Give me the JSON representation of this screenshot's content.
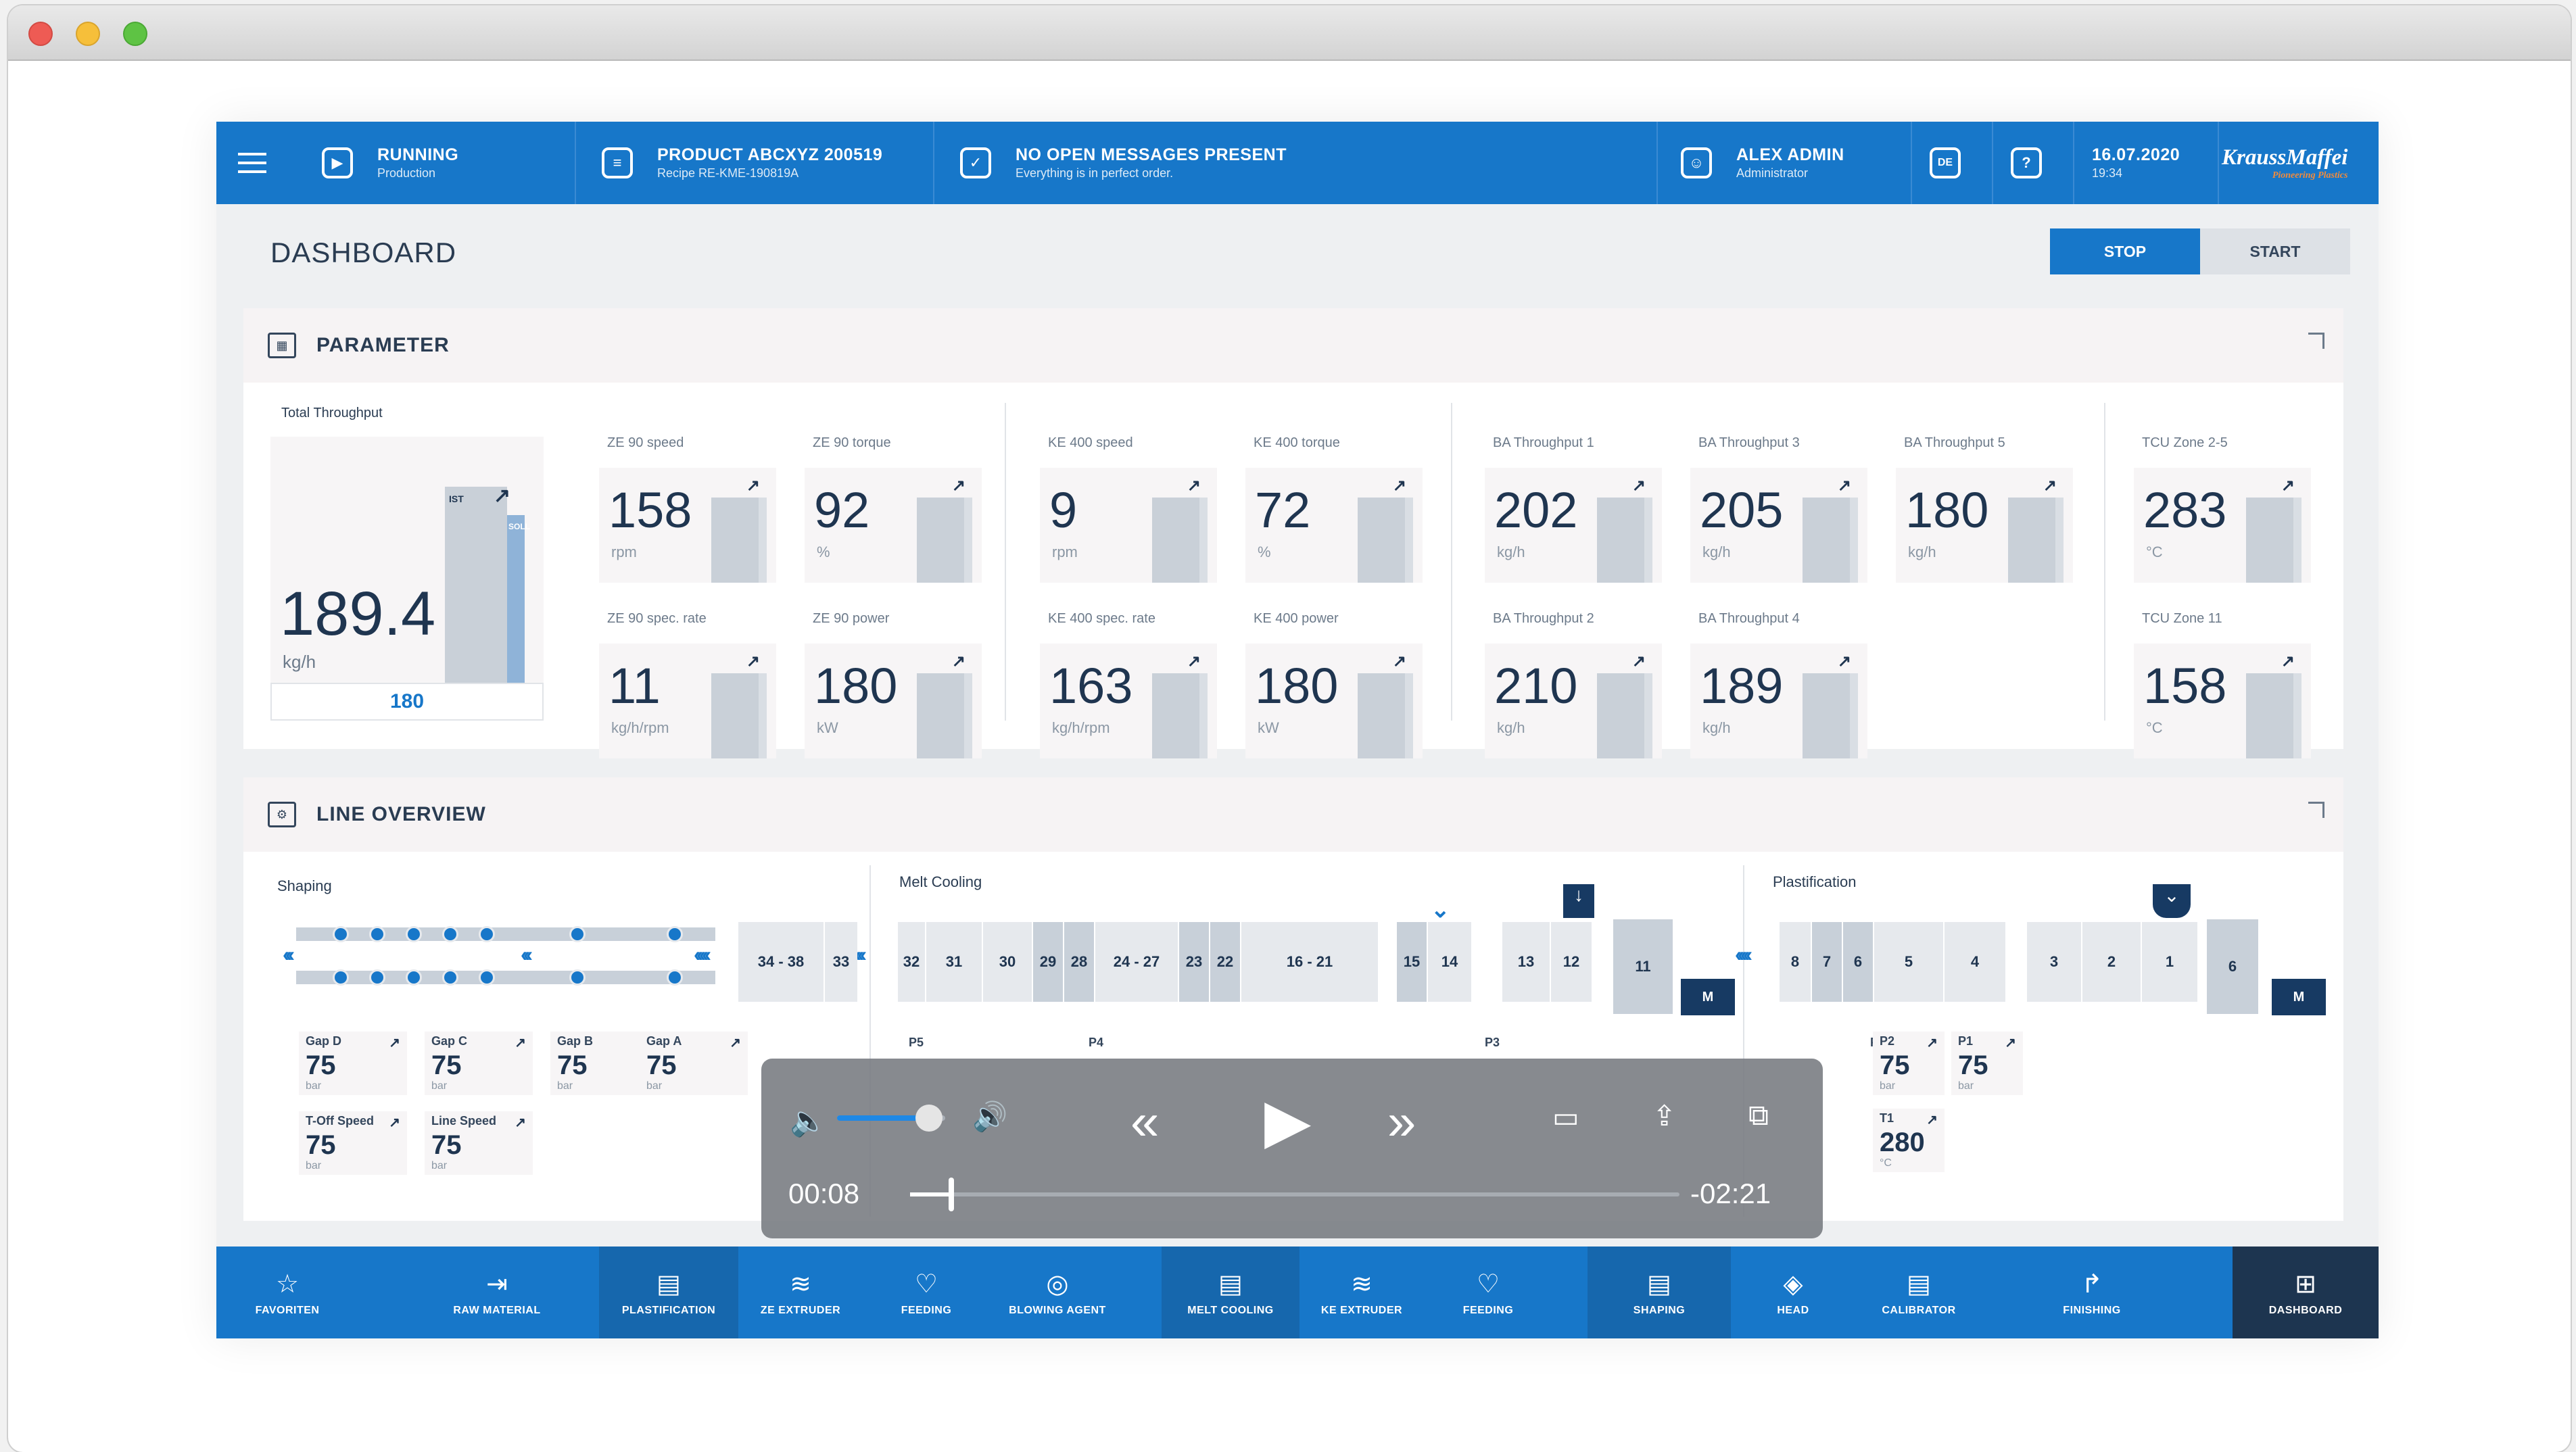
{
  "topbar": {
    "status": {
      "title": "RUNNING",
      "sub": "Production"
    },
    "product": {
      "title": "PRODUCT ABCXYZ 200519",
      "sub": "Recipe RE-KME-190819A"
    },
    "messages": {
      "title": "NO OPEN MESSAGES PRESENT",
      "sub": "Everything is in perfect order."
    },
    "user": {
      "title": "ALEX ADMIN",
      "sub": "Administrator"
    },
    "lang": "DE",
    "help": "?",
    "date": "16.07.2020",
    "time": "19:34",
    "brand": "KraussMaffei",
    "brand_tag": "Pioneering Plastics"
  },
  "page": {
    "title": "DASHBOARD",
    "stop": "STOP",
    "start": "START"
  },
  "parameter": {
    "title": "PARAMETER",
    "total": {
      "label": "Total Throughput",
      "value": "189.4",
      "unit": "kg/h",
      "target": "180",
      "ist": "IST",
      "soll": "SOLL"
    },
    "kpis": [
      {
        "label": "ZE 90 speed",
        "value": "158",
        "unit": "rpm"
      },
      {
        "label": "ZE 90 torque",
        "value": "92",
        "unit": "%"
      },
      {
        "label": "ZE 90 spec. rate",
        "value": "11",
        "unit": "kg/h/rpm"
      },
      {
        "label": "ZE 90 power",
        "value": "180",
        "unit": "kW"
      },
      {
        "label": "KE 400 speed",
        "value": "9",
        "unit": "rpm"
      },
      {
        "label": "KE 400 torque",
        "value": "72",
        "unit": "%"
      },
      {
        "label": "KE 400 spec. rate",
        "value": "163",
        "unit": "kg/h/rpm"
      },
      {
        "label": "KE 400 power",
        "value": "180",
        "unit": "kW"
      },
      {
        "label": "BA Throughput 1",
        "value": "202",
        "unit": "kg/h"
      },
      {
        "label": "BA Throughput 3",
        "value": "205",
        "unit": "kg/h"
      },
      {
        "label": "BA Throughput 5",
        "value": "180",
        "unit": "kg/h"
      },
      {
        "label": "BA Throughput 2",
        "value": "210",
        "unit": "kg/h"
      },
      {
        "label": "BA Throughput 4",
        "value": "189",
        "unit": "kg/h"
      },
      {
        "label": "TCU Zone 2-5",
        "value": "283",
        "unit": "°C"
      },
      {
        "label": "TCU Zone 11",
        "value": "158",
        "unit": "°C"
      }
    ]
  },
  "line": {
    "title": "LINE OVERVIEW",
    "zones": [
      "Shaping",
      "Melt Cooling",
      "Plastification"
    ],
    "segments": [
      "34 - 38",
      "33",
      "32",
      "31",
      "30",
      "29",
      "28",
      "24 - 27",
      "23",
      "22",
      "16 - 21",
      "15",
      "14",
      "13",
      "12",
      "11",
      "M",
      "8",
      "7",
      "6",
      "5",
      "4",
      "3",
      "2",
      "1",
      "6",
      "M"
    ],
    "probes": [
      "P5",
      "P4",
      "P3",
      "P2",
      "P1"
    ],
    "shaping_values": [
      {
        "label": "Gap D",
        "value": "75",
        "unit": "bar"
      },
      {
        "label": "Gap C",
        "value": "75",
        "unit": "bar"
      },
      {
        "label": "Gap B",
        "value": "75",
        "unit": "bar"
      },
      {
        "label": "Gap A",
        "value": "75",
        "unit": "bar"
      },
      {
        "label": "T-Off Speed",
        "value": "75",
        "unit": "bar"
      },
      {
        "label": "Line Speed",
        "value": "75",
        "unit": "bar"
      }
    ],
    "plast_values": [
      {
        "label": "P2",
        "value": "75",
        "unit": "bar"
      },
      {
        "label": "P1",
        "value": "75",
        "unit": "bar"
      },
      {
        "label": "T1",
        "value": "280",
        "unit": "°C"
      }
    ]
  },
  "nav": [
    "FAVORITEN",
    "RAW MATERIAL",
    "PLASTIFICATION",
    "ZE EXTRUDER",
    "FEEDING",
    "BLOWING AGENT",
    "MELT COOLING",
    "KE EXTRUDER",
    "FEEDING",
    "SHAPING",
    "HEAD",
    "CALIBRATOR",
    "FINISHING",
    "DASHBOARD"
  ],
  "video": {
    "elapsed": "00:08",
    "remaining": "-02:21",
    "progress": 0.05,
    "volume": 0.85
  }
}
